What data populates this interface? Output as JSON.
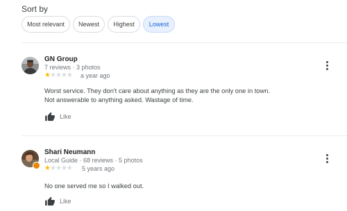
{
  "sort": {
    "label": "Sort by",
    "options": [
      {
        "label": "Most relevant",
        "selected": false
      },
      {
        "label": "Newest",
        "selected": false
      },
      {
        "label": "Highest",
        "selected": false
      },
      {
        "label": "Lowest",
        "selected": true
      }
    ]
  },
  "reviews": [
    {
      "name": "GN Group",
      "meta": "7 reviews · 3 photos",
      "rating": 1,
      "max_rating": 5,
      "time": "a year ago",
      "text": "Worst service. They don't care about anything as they are the only one in town.\nNot answerable to anything asked. Wastage of time.",
      "like_label": "Like",
      "local_guide": false
    },
    {
      "name": "Shari Neumann",
      "meta": "Local Guide · 68 reviews · 5 photos",
      "rating": 1,
      "max_rating": 5,
      "time": "5 years ago",
      "text": "No one served me so I walked out.",
      "like_label": "Like",
      "local_guide": true
    }
  ],
  "colors": {
    "star_filled": "#fbbc04",
    "star_empty": "#dadce0",
    "chip_selected_bg": "#e8f0fe",
    "chip_selected_text": "#1967d2",
    "local_guide_badge": "#ea8600"
  }
}
